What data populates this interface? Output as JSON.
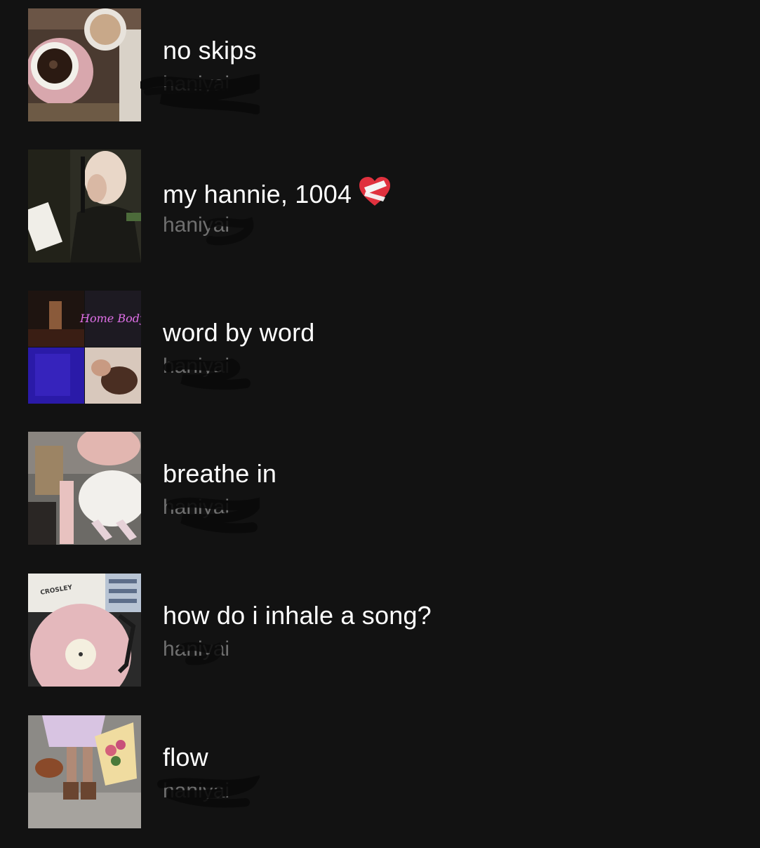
{
  "playlists": [
    {
      "title": "no skips",
      "owner": "haniyai",
      "cover": "coffee-cover-icon"
    },
    {
      "title": "my hannie, 1004",
      "owner": "haniyai",
      "cover": "studio-singer-cover-icon",
      "emoji": "mending-heart-icon"
    },
    {
      "title": "word by word",
      "owner": "haniyai",
      "cover": "mosaic-cover-icon",
      "cover_text": "Home Body"
    },
    {
      "title": "breathe in",
      "owner": "haniyai",
      "cover": "fashion-cover-icon"
    },
    {
      "title": "how do i inhale a song?",
      "owner": "haniyai",
      "cover": "vinyl-turntable-cover-icon",
      "cover_text": "CROSLEY"
    },
    {
      "title": "flow",
      "owner": "haniyai",
      "cover": "flowers-cover-icon"
    }
  ],
  "colors": {
    "background": "#121212",
    "title": "#ffffff",
    "subtitle": "#6f6f6f"
  }
}
